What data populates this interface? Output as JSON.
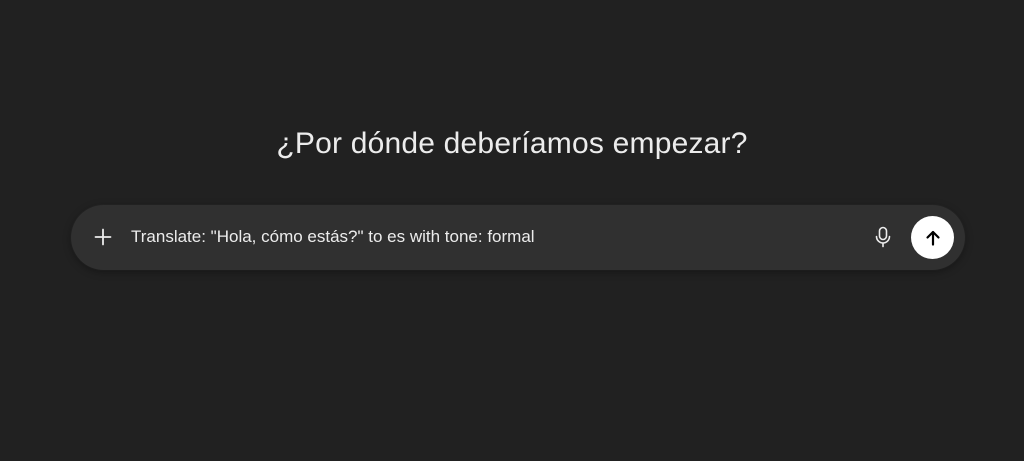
{
  "heading": {
    "text": "¿Por dónde deberíamos empezar?"
  },
  "composer": {
    "input_value": "Translate: \"Hola, cómo estás?\" to es with tone: formal",
    "icons": {
      "attach": "plus-icon",
      "voice": "microphone-icon",
      "send": "arrow-up-icon"
    }
  },
  "colors": {
    "background": "#212121",
    "composer": "#303030",
    "text": "#ececec",
    "send_button": "#ffffff",
    "send_icon": "#000000"
  }
}
